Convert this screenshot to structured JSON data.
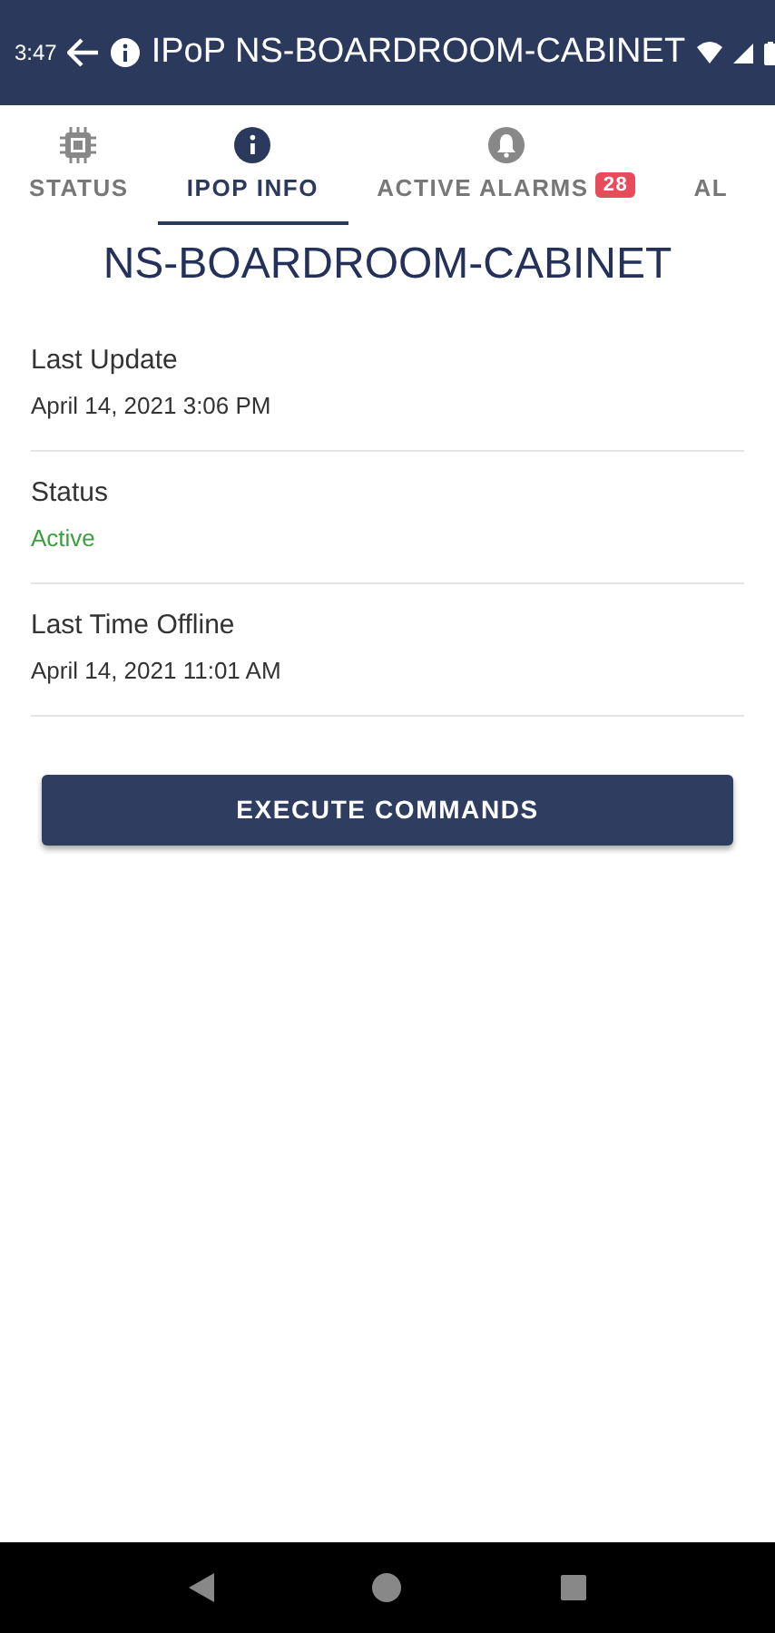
{
  "status_bar": {
    "time": "3:47"
  },
  "app_bar": {
    "title": "IPoP NS-BOARDROOM-CABINET"
  },
  "tabs": [
    {
      "label": "STATUS",
      "kind": "chip",
      "selected": false
    },
    {
      "label": "IPOP INFO",
      "kind": "info",
      "selected": true
    },
    {
      "label": "ACTIVE ALARMS",
      "kind": "bell",
      "badge": "28",
      "selected": false
    },
    {
      "label": "AL",
      "kind": "plain",
      "selected": false
    }
  ],
  "heading": "NS-BOARDROOM-CABINET",
  "fields": [
    {
      "label": "Last Update",
      "value": "April 14, 2021 3:06 PM",
      "kind": "plain"
    },
    {
      "label": "Status",
      "value": "Active",
      "kind": "status"
    },
    {
      "label": "Last Time Offline",
      "value": "April 14, 2021 11:01 AM",
      "kind": "plain"
    }
  ],
  "button": "EXECUTE COMMANDS"
}
